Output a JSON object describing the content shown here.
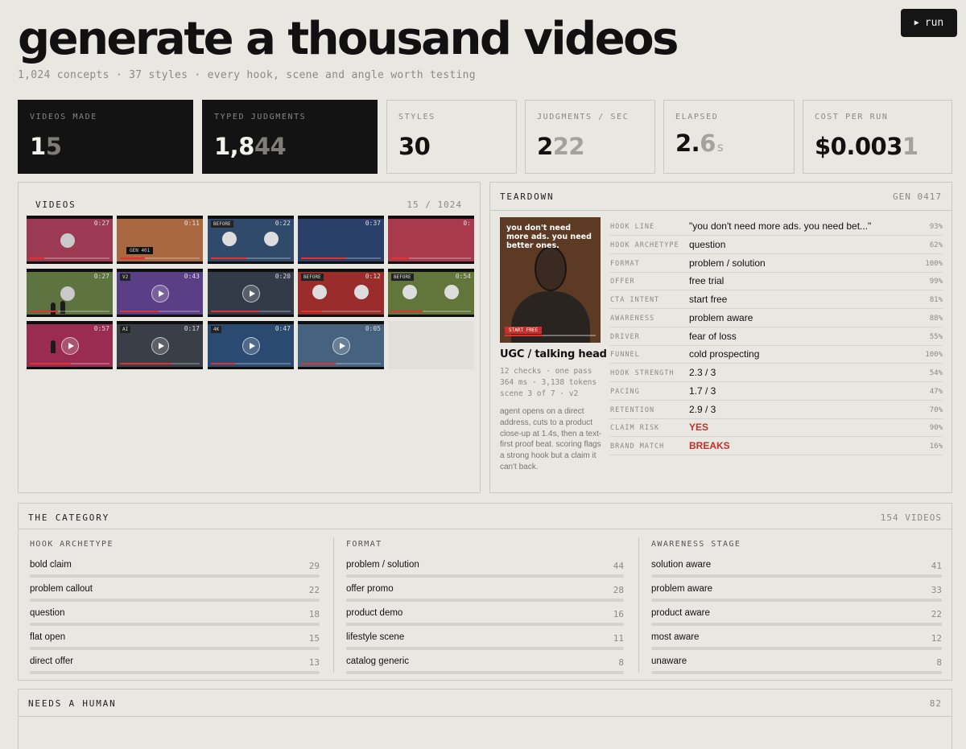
{
  "header": {
    "title": "generate a thousand videos",
    "subtitle": "1,024 concepts · 37 styles · every hook, scene and angle worth testing",
    "run_label": "run"
  },
  "stats": [
    {
      "label": "VIDEOS MADE",
      "bright": "1",
      "dim": "5",
      "unit": ""
    },
    {
      "label": "TYPED JUDGMENTS",
      "bright": "1,8",
      "dim": "44",
      "unit": ""
    },
    {
      "label": "STYLES",
      "bright": "30",
      "dim": "",
      "unit": ""
    },
    {
      "label": "JUDGMENTS / SEC",
      "bright": "2",
      "dim": "22",
      "unit": ""
    },
    {
      "label": "ELAPSED",
      "bright": "2.",
      "dim": "6",
      "unit": "s"
    },
    {
      "label": "COST PER RUN",
      "bright": "$0.003",
      "dim": "1",
      "unit": ""
    }
  ],
  "videos": {
    "heading": "VIDEOS",
    "counter": "15 / 1024",
    "thumbs": [
      {
        "bg": "#9b3a52",
        "ts": "0:27",
        "tag": "",
        "play": false
      },
      {
        "bg": "#a9683f",
        "ts": "0:11",
        "tag": "GEN 401",
        "play": false
      },
      {
        "bg": "#2f4a6a",
        "ts": "0:22",
        "tag": "BEFORE",
        "play": false
      },
      {
        "bg": "#2a3f6a",
        "ts": "0:37",
        "tag": "",
        "play": false
      },
      {
        "bg": "#a93a4e",
        "ts": "0:",
        "tag": "",
        "play": false
      },
      {
        "bg": "#5d7440",
        "ts": "0:27",
        "tag": "",
        "play": false
      },
      {
        "bg": "#5a3f86",
        "ts": "0:43",
        "tag": "V2",
        "play": true
      },
      {
        "bg": "#333a48",
        "ts": "0:20",
        "tag": "",
        "play": true
      },
      {
        "bg": "#9b2c2c",
        "ts": "0:12",
        "tag": "BEFORE",
        "play": false
      },
      {
        "bg": "#62763c",
        "ts": "0:54",
        "tag": "BEFORE",
        "play": false
      },
      {
        "bg": "#9a2c52",
        "ts": "0:57",
        "tag": "",
        "play": true
      },
      {
        "bg": "#3a3e46",
        "ts": "0:17",
        "tag": "AI",
        "play": true
      },
      {
        "bg": "#2a4a72",
        "ts": "0:47",
        "tag": "4K",
        "play": true
      },
      {
        "bg": "#45627f",
        "ts": "0:05",
        "tag": "",
        "play": true
      },
      {
        "bg": "#dedcd6",
        "ts": "",
        "tag": "",
        "play": false
      }
    ]
  },
  "teardown": {
    "heading": "TEARDOWN",
    "gen": "GEN 0417",
    "image_caption": "you don't need more ads. you need better ones.",
    "image_cta": "START FREE",
    "style": "UGC / talking head",
    "meta1": "12 checks · one pass",
    "meta2": "364 ms · 3,138 tokens",
    "meta3": "scene 3 of 7 · v2",
    "description": "agent opens on a direct address, cuts to a product close-up at 1.4s, then a text-first proof beat. scoring flags a strong hook but a claim it can't back.",
    "rows": [
      {
        "key": "HOOK LINE",
        "value": "\"you don't need more ads. you need bet...\"",
        "pct": "93%",
        "flag": false
      },
      {
        "key": "HOOK ARCHETYPE",
        "value": "question",
        "pct": "62%",
        "flag": false
      },
      {
        "key": "FORMAT",
        "value": "problem / solution",
        "pct": "100%",
        "flag": false
      },
      {
        "key": "OFFER",
        "value": "free trial",
        "pct": "99%",
        "flag": false
      },
      {
        "key": "CTA INTENT",
        "value": "start free",
        "pct": "81%",
        "flag": false
      },
      {
        "key": "AWARENESS",
        "value": "problem aware",
        "pct": "88%",
        "flag": false
      },
      {
        "key": "DRIVER",
        "value": "fear of loss",
        "pct": "55%",
        "flag": false
      },
      {
        "key": "FUNNEL",
        "value": "cold prospecting",
        "pct": "100%",
        "flag": false
      },
      {
        "key": "HOOK STRENGTH",
        "value": "2.3 / 3",
        "pct": "54%",
        "flag": false
      },
      {
        "key": "PACING",
        "value": "1.7 / 3",
        "pct": "47%",
        "flag": false
      },
      {
        "key": "RETENTION",
        "value": "2.9 / 3",
        "pct": "70%",
        "flag": false
      },
      {
        "key": "CLAIM RISK",
        "value": "YES",
        "pct": "90%",
        "flag": true
      },
      {
        "key": "BRAND MATCH",
        "value": "BREAKS",
        "pct": "16%",
        "flag": true
      }
    ]
  },
  "category": {
    "heading": "THE CATEGORY",
    "count": "154 VIDEOS",
    "columns": [
      {
        "title": "HOOK ARCHETYPE",
        "items": [
          {
            "name": "bold claim",
            "count": "29"
          },
          {
            "name": "problem callout",
            "count": "22"
          },
          {
            "name": "question",
            "count": "18"
          },
          {
            "name": "flat open",
            "count": "15"
          },
          {
            "name": "direct offer",
            "count": "13"
          }
        ]
      },
      {
        "title": "FORMAT",
        "items": [
          {
            "name": "problem / solution",
            "count": "44"
          },
          {
            "name": "offer promo",
            "count": "28"
          },
          {
            "name": "product demo",
            "count": "16"
          },
          {
            "name": "lifestyle scene",
            "count": "11"
          },
          {
            "name": "catalog generic",
            "count": "8"
          }
        ]
      },
      {
        "title": "AWARENESS STAGE",
        "items": [
          {
            "name": "solution aware",
            "count": "41"
          },
          {
            "name": "problem aware",
            "count": "33"
          },
          {
            "name": "product aware",
            "count": "22"
          },
          {
            "name": "most aware",
            "count": "12"
          },
          {
            "name": "unaware",
            "count": "8"
          }
        ]
      }
    ]
  },
  "needs_human": {
    "heading": "NEEDS A HUMAN",
    "count": "82"
  }
}
